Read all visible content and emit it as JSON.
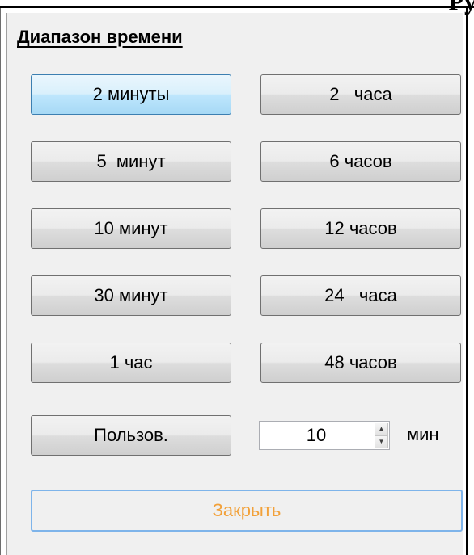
{
  "header_fragment": "Ру",
  "group": {
    "title": "Диапазон времени"
  },
  "buttons": {
    "min2": "2 минуты",
    "h2": "2   часа",
    "min5": "5  минут",
    "h6": "6 часов",
    "min10": "10 минут",
    "h12": "12 часов",
    "min30": "30 минут",
    "h24": "24   часа",
    "h1": "1 час",
    "h48": "48 часов",
    "custom": "Пользов.",
    "close": "Закрыть"
  },
  "selected": "2 минуты",
  "custom_input": {
    "value": "10",
    "unit": "мин"
  },
  "icons": {
    "spin_up": "spin-up-arrow-icon",
    "spin_down": "spin-down-arrow-icon"
  },
  "colors": {
    "selected_button": "#bee6fd",
    "close_text": "#f2a13a",
    "close_border": "#7eb4ea",
    "panel_bg": "#f0f0f0"
  }
}
